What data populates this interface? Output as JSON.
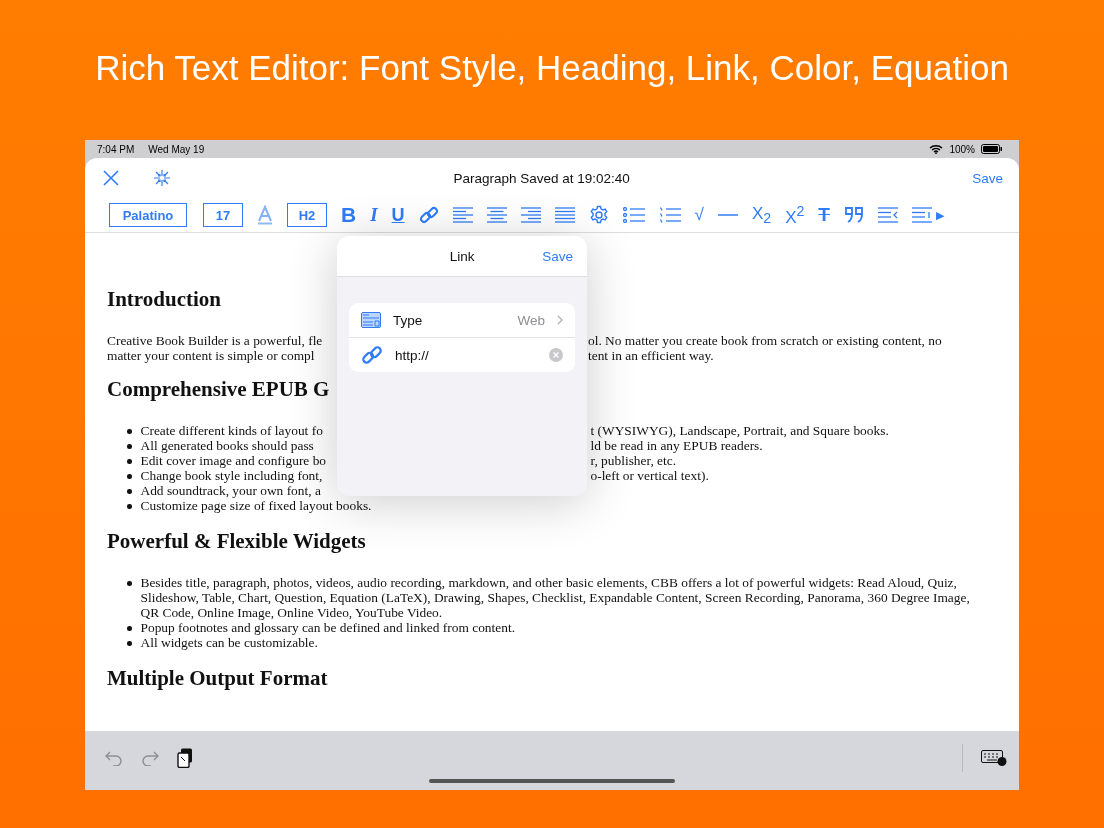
{
  "headline": "Rich Text Editor: Font Style, Heading, Link, Color, Equation",
  "status_bar": {
    "time": "7:04 PM",
    "date": "Wed May 19",
    "battery": "100%"
  },
  "nav": {
    "title": "Paragraph Saved at 19:02:40",
    "save": "Save"
  },
  "toolbar": [
    {
      "kind": "font",
      "label": "Palatino"
    },
    {
      "kind": "size",
      "label": "17"
    },
    {
      "kind": "text-color"
    },
    {
      "kind": "heading",
      "label": "H2"
    },
    {
      "kind": "bold",
      "label": "B"
    },
    {
      "kind": "italic",
      "label": "I"
    },
    {
      "kind": "underline",
      "label": "U"
    },
    {
      "kind": "link"
    },
    {
      "kind": "align-left"
    },
    {
      "kind": "align-center"
    },
    {
      "kind": "align-right"
    },
    {
      "kind": "justify"
    },
    {
      "kind": "settings"
    },
    {
      "kind": "bullet-list"
    },
    {
      "kind": "numbered-list"
    },
    {
      "kind": "equation",
      "label": "√"
    },
    {
      "kind": "rule"
    },
    {
      "kind": "script",
      "label": "X$_{2}$"
    },
    {
      "kind": "script",
      "label": "X$^{2}$"
    },
    {
      "kind": "strike",
      "label": "T"
    },
    {
      "kind": "quote"
    },
    {
      "kind": "outdent"
    },
    {
      "kind": "indent"
    },
    {
      "kind": "more",
      "label": "▶"
    }
  ],
  "document": [
    {
      "kind": "heading",
      "lines": [
        {
          "left": "Introduction"
        }
      ]
    },
    {
      "kind": "paragraph",
      "lines": [
        {
          "left": "Creative Book Builder is a powerful, fle",
          "right": "ol. No matter you create book from scratch or existing content, no"
        },
        {
          "left": "matter your content is simple or compl",
          "right": "tent in an efficient way."
        }
      ]
    },
    {
      "kind": "heading",
      "lines": [
        {
          "left": "Comprehensive EPUB G"
        }
      ]
    },
    {
      "kind": "bullets",
      "items": [
        {
          "left": "Create different kinds of layout fo",
          "right": "t (WYSIWYG), Landscape, Portrait, and Square books."
        },
        {
          "left": "All generated books should pass",
          "right": "ld be read in any EPUB readers."
        },
        {
          "left": "Edit cover image and configure bo",
          "right": "r, publisher, etc."
        },
        {
          "left": "Change book style including font,",
          "right": "o-left or vertical text)."
        },
        {
          "left": "Add soundtrack, your own font, a"
        },
        {
          "left": "Customize page size of fixed layout books."
        }
      ]
    },
    {
      "kind": "heading",
      "lines": [
        {
          "left": "Powerful & Flexible Widgets"
        }
      ]
    },
    {
      "kind": "bullets",
      "items": [
        {
          "left": "Besides title, paragraph, photos, videos, audio recording, markdown, and other basic elements, CBB offers a lot of powerful widgets: Read Aloud, Quiz, Slideshow, Table, Chart, Question, Equation (LaTeX), Drawing, Shapes, Checklist, Expandable Content, Screen Recording, Panorama, 360 Degree Image, QR Code, Online Image, Online Video, YouTube Video."
        },
        {
          "left": "Popup footnotes and glossary can be defined and linked from content."
        },
        {
          "left": "All widgets can be customizable."
        }
      ]
    },
    {
      "kind": "heading",
      "lines": [
        {
          "left": "Multiple Output Format"
        }
      ]
    }
  ],
  "link_popup": {
    "title": "Link",
    "save": "Save",
    "type_label": "Type",
    "type_value": "Web",
    "url": "http://"
  }
}
